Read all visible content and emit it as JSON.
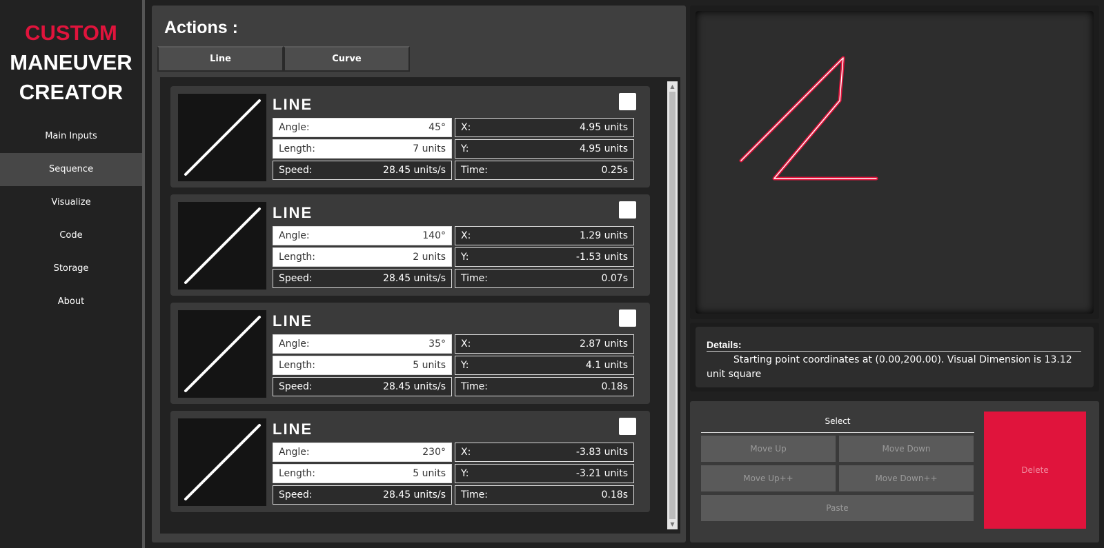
{
  "logo": {
    "line1": "CUSTOM",
    "line2": "MANEUVER",
    "line3": "CREATOR"
  },
  "nav": {
    "items": [
      {
        "label": "Main Inputs"
      },
      {
        "label": "Sequence"
      },
      {
        "label": "Visualize"
      },
      {
        "label": "Code"
      },
      {
        "label": "Storage"
      },
      {
        "label": "About"
      }
    ],
    "active": "Sequence"
  },
  "actions": {
    "title": "Actions :",
    "tabs": [
      {
        "label": "Line"
      },
      {
        "label": "Curve"
      }
    ],
    "cards": [
      {
        "title": "LINE",
        "angle_label": "Angle:",
        "angle": "45°",
        "length_label": "Length:",
        "length": "7 units",
        "speed_label": "Speed:",
        "speed": "28.45 units/s",
        "x_label": "X:",
        "x": "4.95 units",
        "y_label": "Y:",
        "y": "4.95 units",
        "time_label": "Time:",
        "time": "0.25s"
      },
      {
        "title": "LINE",
        "angle_label": "Angle:",
        "angle": "140°",
        "length_label": "Length:",
        "length": "2 units",
        "speed_label": "Speed:",
        "speed": "28.45 units/s",
        "x_label": "X:",
        "x": "1.29 units",
        "y_label": "Y:",
        "y": "-1.53 units",
        "time_label": "Time:",
        "time": "0.07s"
      },
      {
        "title": "LINE",
        "angle_label": "Angle:",
        "angle": "35°",
        "length_label": "Length:",
        "length": "5 units",
        "speed_label": "Speed:",
        "speed": "28.45 units/s",
        "x_label": "X:",
        "x": "2.87 units",
        "y_label": "Y:",
        "y": "4.1 units",
        "time_label": "Time:",
        "time": "0.18s"
      },
      {
        "title": "LINE",
        "angle_label": "Angle:",
        "angle": "230°",
        "length_label": "Length:",
        "length": "5 units",
        "speed_label": "Speed:",
        "speed": "28.45 units/s",
        "x_label": "X:",
        "x": "-3.83 units",
        "y_label": "Y:",
        "y": "-3.21 units",
        "time_label": "Time:",
        "time": "0.18s"
      }
    ]
  },
  "visual": {
    "path_color": "#e0143c",
    "path_inner_color": "#ffffff"
  },
  "details": {
    "title": "Details:",
    "text": "Starting point coordinates at (0.00,200.00). Visual Dimension is 13.12 unit square"
  },
  "controls": {
    "select_label": "Select",
    "move_up": "Move Up",
    "move_down": "Move Down",
    "move_up_pp": "Move Up++",
    "move_down_pp": "Move Down++",
    "paste": "Paste",
    "delete": "Delete"
  },
  "colors": {
    "accent": "#e0143c",
    "background": "#202020",
    "panel": "#3f3f3f"
  }
}
